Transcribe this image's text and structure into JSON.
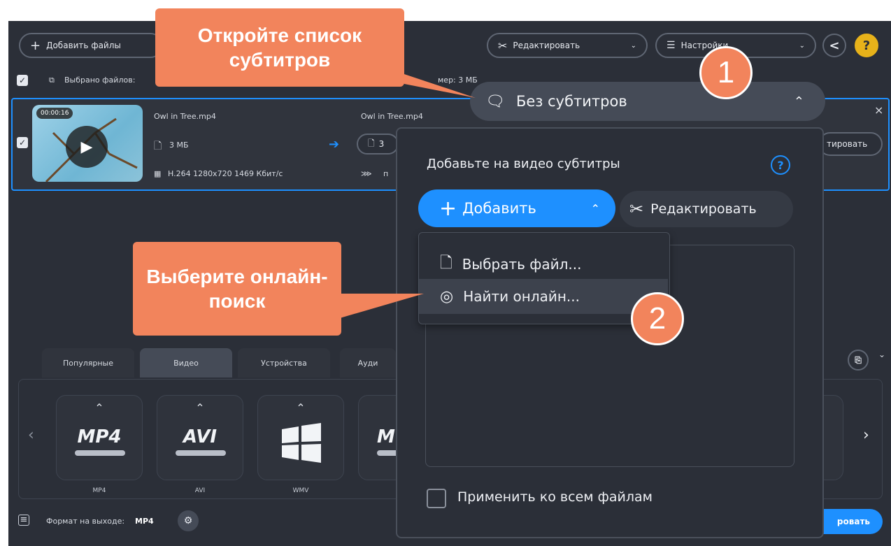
{
  "toolbar": {
    "add_files": "Добавить файлы",
    "edit": "Редактировать",
    "settings": "Настройки",
    "help": "?"
  },
  "files_bar": {
    "selected": "Выбрано файлов:",
    "size": "мер: 3 МБ"
  },
  "file": {
    "duration": "00:00:16",
    "source_name": "Owl in Tree.mp4",
    "source_size": "3 МБ",
    "codec": "H.264 1280x720 1469 Кбит/с",
    "output_name": "Owl in Tree.mp4",
    "output_size": "3",
    "output_extra": "п",
    "edit_button": "тировать"
  },
  "subtitles_dropdown": {
    "label": "Без субтитров"
  },
  "subtitle_panel": {
    "title": "Добавьте на видео субтитры",
    "add_button": "Добавить",
    "edit_button": "Редактировать",
    "menu": [
      {
        "label": "Выбрать файл...",
        "icon": "file-icon"
      },
      {
        "label": "Найти онлайн...",
        "icon": "search-online-icon"
      }
    ],
    "apply_all": "Применить ко всем файлам"
  },
  "format_tabs": [
    "Популярные",
    "Видео",
    "Устройства",
    "Ауди"
  ],
  "formats": [
    {
      "name": "MP4",
      "label": "MP4"
    },
    {
      "name": "AVI",
      "label": "AVI"
    },
    {
      "name": "",
      "label": "WMV"
    },
    {
      "name": "M",
      "label": ""
    }
  ],
  "output": {
    "label": "Формат на выходе:",
    "value": "MP4",
    "convert_button": "ровать"
  },
  "callouts": {
    "open_list": "Откройте список субтитров",
    "choose_online": "Выберите онлайн-поиск",
    "step1": "1",
    "step2": "2"
  },
  "colors": {
    "background": "#2b2f38",
    "accent": "#1e90ff",
    "callout": "#f2845c"
  }
}
